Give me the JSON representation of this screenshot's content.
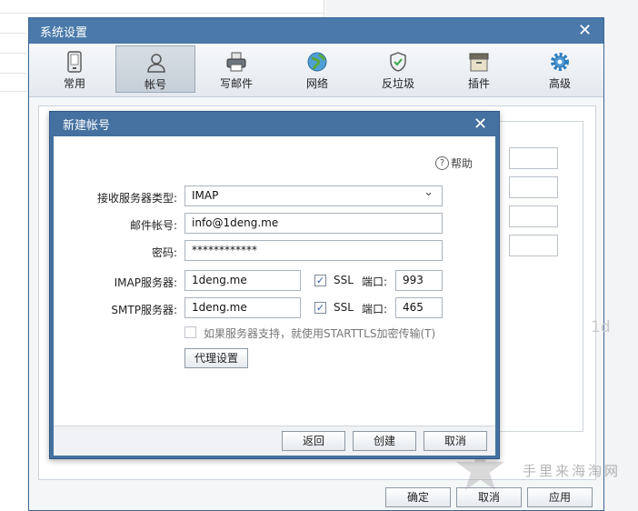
{
  "system_window": {
    "title": "系统设置",
    "close_glyph": "✕",
    "toolbar": [
      {
        "label": "常用",
        "icon": "phone-icon"
      },
      {
        "label": "帐号",
        "icon": "user-icon",
        "active": true
      },
      {
        "label": "写邮件",
        "icon": "printer-icon"
      },
      {
        "label": "网络",
        "icon": "globe-icon"
      },
      {
        "label": "反垃圾",
        "icon": "shield-icon"
      },
      {
        "label": "插件",
        "icon": "box-icon"
      },
      {
        "label": "高级",
        "icon": "gear-icon"
      }
    ],
    "buttons": {
      "ok": "确定",
      "cancel": "取消",
      "apply": "应用"
    }
  },
  "dialog": {
    "title": "新建帐号",
    "close_glyph": "✕",
    "help_label": "帮助",
    "help_glyph": "?",
    "server_type": {
      "label": "接收服务器类型:",
      "value": "IMAP",
      "arrow": "⌄"
    },
    "email": {
      "label": "邮件帐号:",
      "value": "info@1deng.me"
    },
    "password": {
      "label": "密码:",
      "value": "************"
    },
    "imap": {
      "label": "IMAP服务器:",
      "value": "1deng.me",
      "ssl_label": "SSL",
      "ssl_checked": true,
      "port_label": "端口:",
      "port": "993"
    },
    "smtp": {
      "label": "SMTP服务器:",
      "value": "1deng.me",
      "ssl_label": "SSL",
      "ssl_checked": true,
      "port_label": "端口:",
      "port": "465"
    },
    "starttls": {
      "label": "如果服务器支持，就使用STARTTLS加密传输(T)",
      "checked": false
    },
    "proxy_button": "代理设置",
    "buttons": {
      "back": "返回",
      "create": "创建",
      "cancel": "取消"
    },
    "check_glyph": "✓"
  },
  "background": {
    "partial_text": "1d"
  },
  "watermark": {
    "text": "手里来海淘网",
    "star": "★"
  }
}
